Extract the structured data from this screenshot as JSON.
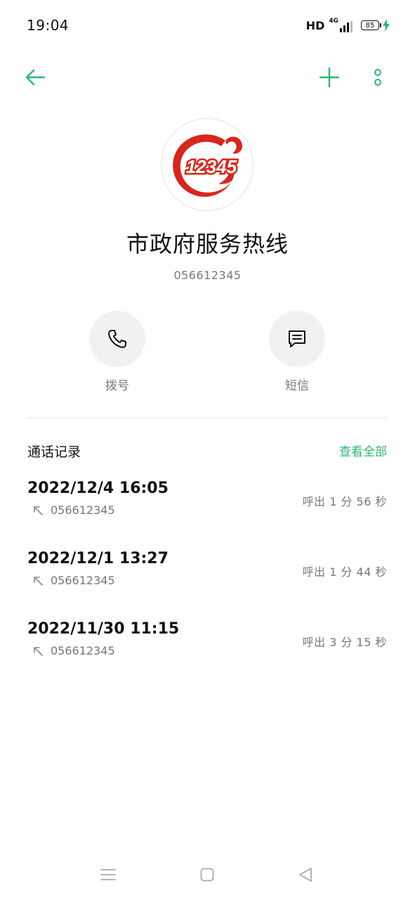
{
  "status_bar": {
    "time": "19:04",
    "hd": "HD",
    "network": "4G",
    "battery": "85"
  },
  "contact": {
    "name": "市政府服务热线",
    "number": "056612345",
    "logo_text": "12345"
  },
  "actions": {
    "call_label": "拨号",
    "sms_label": "短信"
  },
  "call_log": {
    "title": "通话记录",
    "view_all": "查看全部",
    "items": [
      {
        "datetime": "2022/12/4 16:05",
        "number": "056612345",
        "info": "呼出  1 分 56 秒"
      },
      {
        "datetime": "2022/12/1 13:27",
        "number": "056612345",
        "info": "呼出  1 分 44 秒"
      },
      {
        "datetime": "2022/11/30 11:15",
        "number": "056612345",
        "info": "呼出  3 分 15 秒"
      }
    ]
  },
  "colors": {
    "accent": "#2bb673",
    "logo_red": "#d9261c"
  }
}
